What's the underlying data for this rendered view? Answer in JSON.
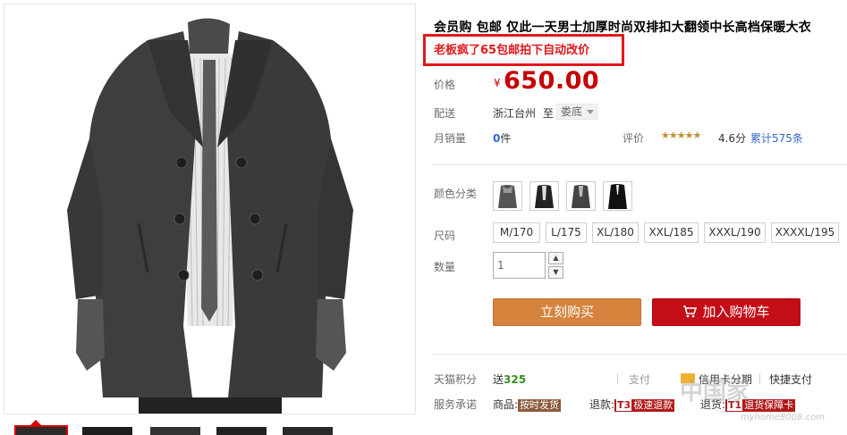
{
  "product": {
    "title": "会员购 包邮 仅此一天男士加厚时尚双排扣大翻领中长高档保暖大衣",
    "promo": "老板疯了65包邮拍下自动改价"
  },
  "price": {
    "label": "价格",
    "currency": "¥",
    "value": "650.00"
  },
  "shipping": {
    "label": "配送",
    "from": "浙江台州",
    "to_prefix": "至",
    "to_value": "娄底"
  },
  "sales": {
    "label": "月销量",
    "count": "0",
    "unit": "件"
  },
  "reviews": {
    "label": "评价",
    "stars": "★★★★★",
    "score": "4.6分",
    "count_text": "累计575条"
  },
  "colors": {
    "label": "颜色分类",
    "swatch_icons": [
      "coat-swatch-gray-fur",
      "coat-swatch-black",
      "coat-swatch-charcoal",
      "coat-swatch-black-long"
    ]
  },
  "sizes": {
    "label": "尺码",
    "options": [
      "M/170",
      "L/175",
      "XL/180",
      "XXL/185",
      "XXXL/190",
      "XXXXL/195"
    ]
  },
  "quantity": {
    "label": "数量",
    "value": "1",
    "up": "▲",
    "down": "▼"
  },
  "actions": {
    "buy_now": "立刻购买",
    "add_to_cart": "加入购物车"
  },
  "points": {
    "label": "天猫积分",
    "prefix": "送",
    "value": "325"
  },
  "payment": {
    "label": "支付",
    "credit": "信用卡分期",
    "quick": "快捷支付"
  },
  "service": {
    "label": "服务承诺",
    "goods_label": "商品:",
    "goods_badge": "按时发货",
    "refund_label": "退款:",
    "refund_code": "T3",
    "refund_badge": "极速退款",
    "return_label": "退货:",
    "return_code": "T1",
    "return_badge": "退货保障卡"
  },
  "watermark": {
    "main": "中国家",
    "sub": "myhome8008.com"
  },
  "colors_theme": {
    "price_red": "#c40000",
    "promo_red": "#e0191c",
    "buy_orange": "#d5833d",
    "cart_red": "#c40d17"
  }
}
